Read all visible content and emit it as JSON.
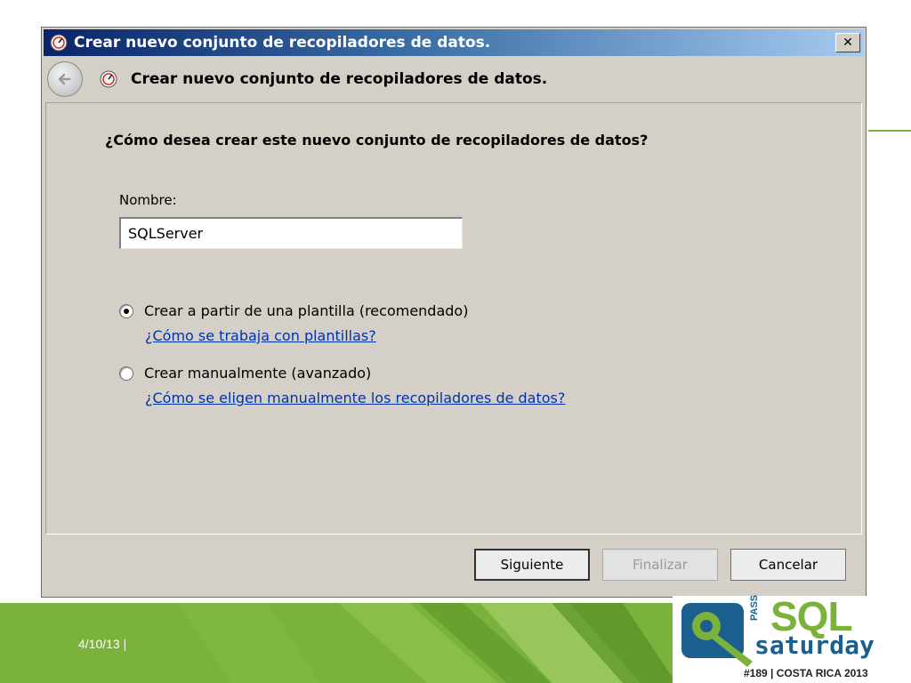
{
  "window": {
    "title": "Crear nuevo conjunto de recopiladores de datos.",
    "close_glyph": "✕"
  },
  "header": {
    "title": "Crear nuevo conjunto de recopiladores de datos."
  },
  "content": {
    "question": "¿Cómo desea crear este nuevo conjunto de recopiladores de datos?",
    "name_label": "Nombre:",
    "name_value": "SQLServer",
    "options": [
      {
        "label": "Crear a partir de una plantilla (recomendado)",
        "selected": true,
        "help_link": "¿Cómo se trabaja con plantillas?"
      },
      {
        "label": "Crear manualmente (avanzado)",
        "selected": false,
        "help_link": "¿Cómo se eligen manualmente los recopiladores de datos?"
      }
    ]
  },
  "buttons": {
    "next": "Siguiente",
    "finish": "Finalizar",
    "cancel": "Cancelar"
  },
  "slide": {
    "date": "4/10/13  |",
    "logo": {
      "sql": "SQL",
      "pass": "PASS",
      "saturday": "saturday",
      "event": "#189 | COSTA RICA 2013"
    }
  },
  "colors": {
    "brand_green": "#7ab23c",
    "brand_blue": "#1b5f8f",
    "link": "#0033aa",
    "dialog_bg": "#d4d0c8"
  }
}
